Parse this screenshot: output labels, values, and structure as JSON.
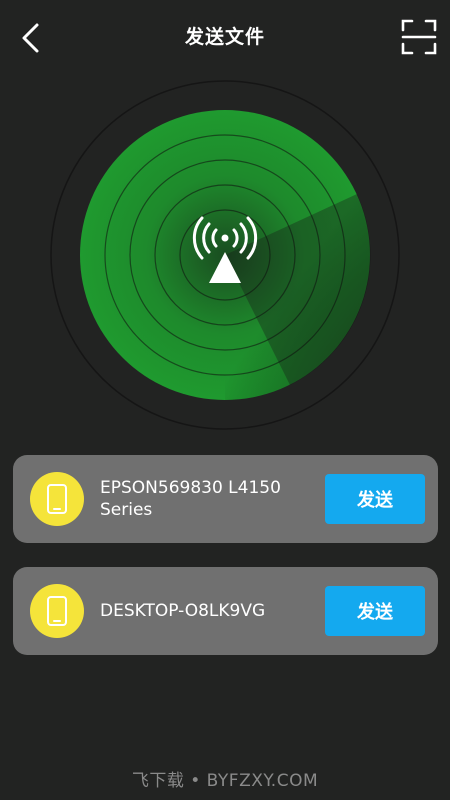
{
  "header": {
    "title": "发送文件",
    "back_icon": "chevron-left-icon",
    "scan_icon": "scan-icon"
  },
  "radar": {
    "icon": "wifi-signal-icon",
    "sweep_color": "#1f9a2f",
    "ring_color": "#0f0f0f"
  },
  "devices": [
    {
      "name": "EPSON569830 L4150 Series",
      "icon": "phone-icon",
      "button_label": "发送"
    },
    {
      "name": "DESKTOP-O8LK9VG",
      "icon": "phone-icon",
      "button_label": "发送"
    }
  ],
  "colors": {
    "background": "#222322",
    "card": "#707070",
    "avatar": "#f5e43a",
    "button": "#14a9ef"
  },
  "watermark": "飞下载 • BYFZXY.COM"
}
